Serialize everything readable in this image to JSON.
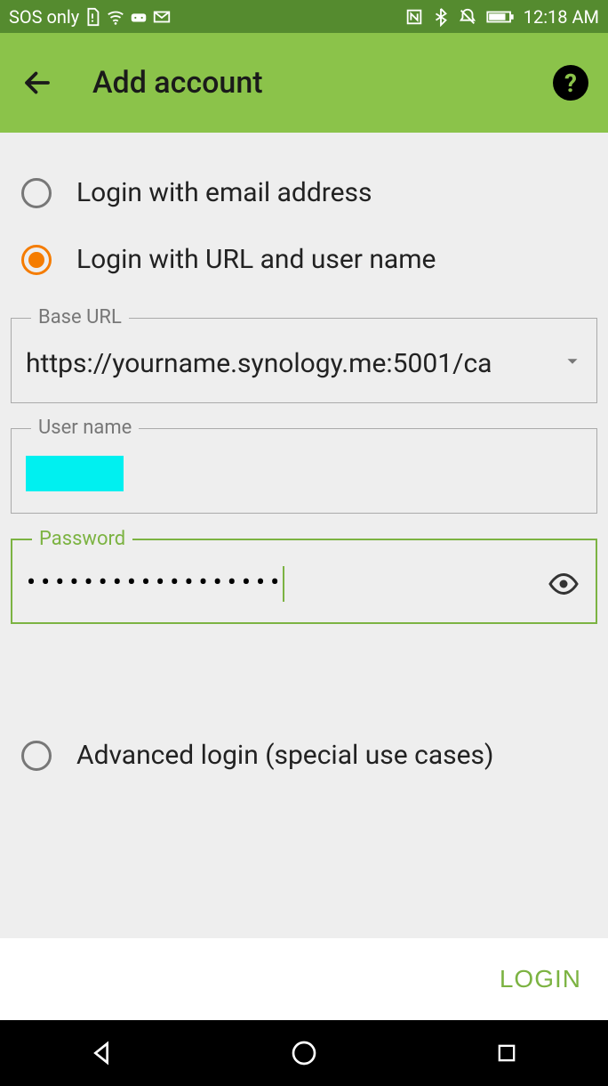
{
  "status": {
    "carrier": "SOS only",
    "time": "12:18 AM"
  },
  "appbar": {
    "title": "Add account"
  },
  "options": {
    "email": {
      "label": "Login with email address",
      "selected": false
    },
    "url": {
      "label": "Login with URL and user name",
      "selected": true
    },
    "advanced": {
      "label": "Advanced login (special use cases)",
      "selected": false
    }
  },
  "form": {
    "base_url": {
      "label": "Base URL",
      "value": "https://yourname.synology.me:5001/ca"
    },
    "username": {
      "label": "User name",
      "value": ""
    },
    "password": {
      "label": "Password",
      "masked": "••••••••••••••••••"
    }
  },
  "footer": {
    "login": "LOGIN"
  }
}
